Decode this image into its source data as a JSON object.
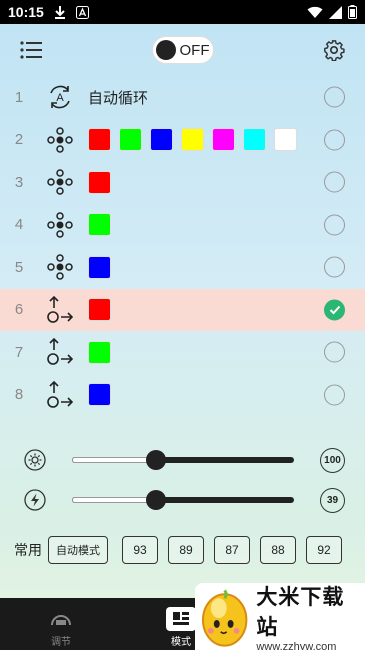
{
  "status": {
    "time": "10:15"
  },
  "toolbar": {
    "power_label": "OFF"
  },
  "rows": [
    {
      "num": "1",
      "icon": "auto-cycle-icon",
      "text": "自动循环",
      "swatches": [],
      "checked": false
    },
    {
      "num": "2",
      "icon": "mode-flash-icon",
      "text": "",
      "swatches": [
        "#ff0000",
        "#00ff00",
        "#0000ff",
        "#ffff00",
        "#ff00ff",
        "#00ffff",
        "#ffffff"
      ],
      "checked": false
    },
    {
      "num": "3",
      "icon": "mode-flash-icon",
      "text": "",
      "swatches": [
        "#ff0000"
      ],
      "checked": false
    },
    {
      "num": "4",
      "icon": "mode-flash-icon",
      "text": "",
      "swatches": [
        "#00ff00"
      ],
      "checked": false
    },
    {
      "num": "5",
      "icon": "mode-flash-icon",
      "text": "",
      "swatches": [
        "#0000ff"
      ],
      "checked": false
    },
    {
      "num": "6",
      "icon": "mode-jump-icon",
      "text": "",
      "swatches": [
        "#ff0000"
      ],
      "checked": true
    },
    {
      "num": "7",
      "icon": "mode-jump-icon",
      "text": "",
      "swatches": [
        "#00ff00"
      ],
      "checked": false
    },
    {
      "num": "8",
      "icon": "mode-jump-icon",
      "text": "",
      "swatches": [
        "#0000ff"
      ],
      "checked": false
    }
  ],
  "sliders": {
    "brightness": {
      "value": "100",
      "level_fraction": 0.38
    },
    "speed": {
      "value": "39",
      "level_fraction": 0.38
    }
  },
  "favorites": {
    "label": "常用",
    "items": [
      "自动模式",
      "93",
      "89",
      "87",
      "88",
      "92"
    ]
  },
  "nav": {
    "adjust_label": "调节",
    "mode_label": "模式"
  },
  "watermark": {
    "title": "大米下载站",
    "url": "www.zzhyw.com"
  },
  "colors": {
    "selected_row": "#fadbd3",
    "check_green": "#2bb673"
  }
}
